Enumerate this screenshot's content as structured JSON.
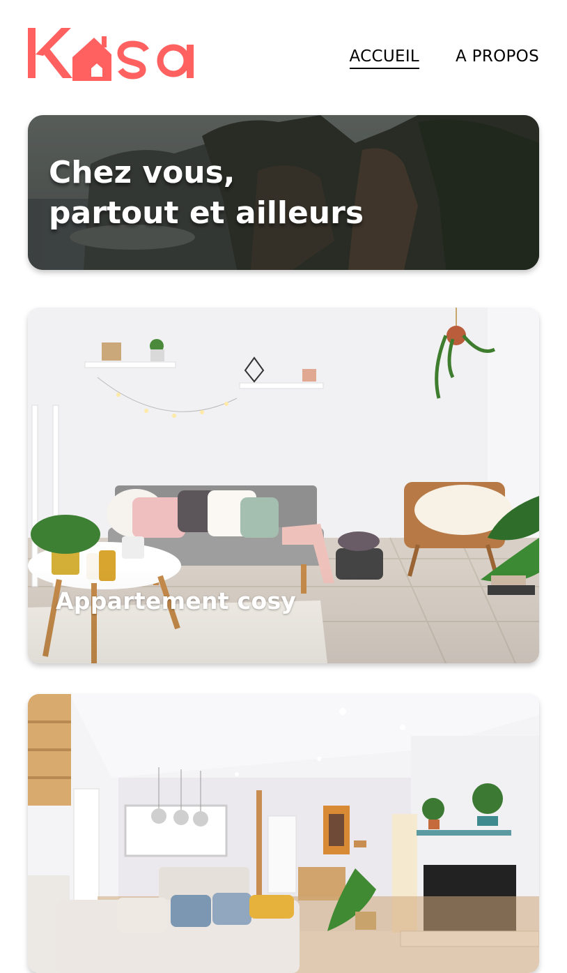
{
  "header": {
    "logo_text": "Kasa",
    "nav": [
      {
        "label": "ACCUEIL",
        "active": true
      },
      {
        "label": "A PROPOS",
        "active": false
      }
    ]
  },
  "hero": {
    "title_line1": "Chez vous,",
    "title_line2": "partout et ailleurs"
  },
  "listings": [
    {
      "title": "Appartement cosy"
    },
    {
      "title": ""
    }
  ],
  "colors": {
    "brand": "#FF6060",
    "text": "#000000",
    "background": "#FFFFFF"
  }
}
